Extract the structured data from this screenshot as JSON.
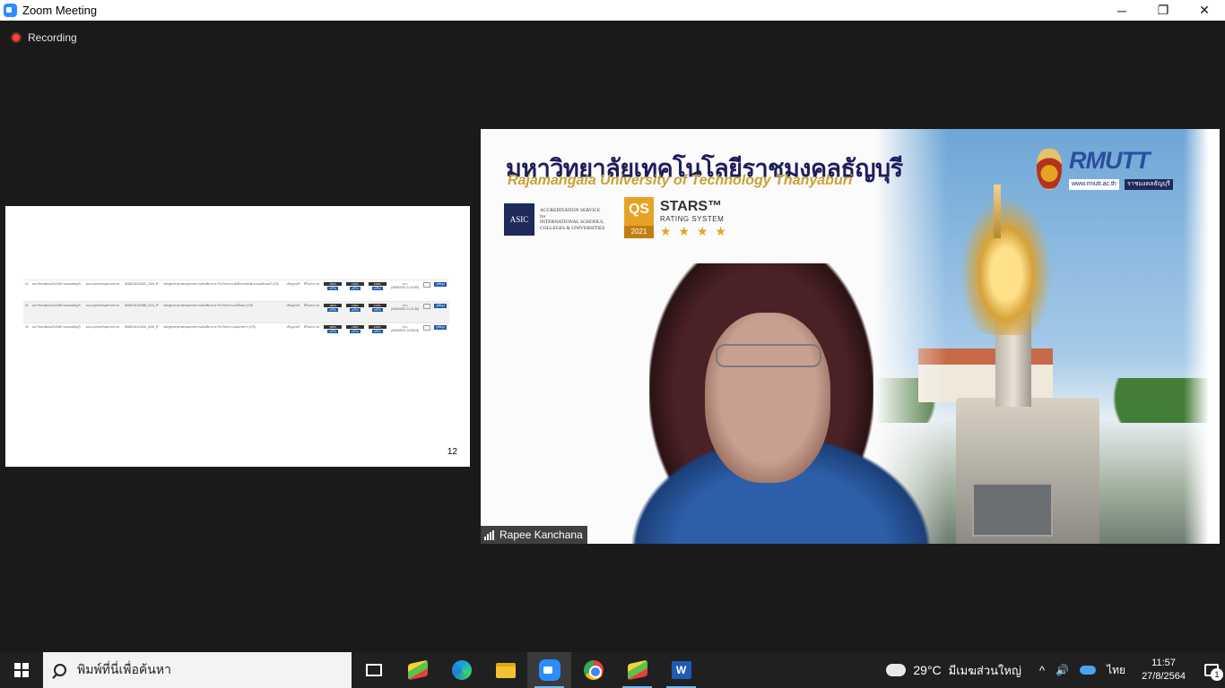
{
  "window": {
    "title": "Zoom Meeting",
    "controls": {
      "minimize": "─",
      "restore": "❐",
      "close": "✕"
    }
  },
  "recording": {
    "label": "Recording"
  },
  "shared_screen": {
    "rows": [
      {
        "no": "01",
        "org": "มหาวิทยาลัยเทคโนโลยีราชมงคลธัญบุรี",
        "faculty": "คณะครุศาสตร์อุตสาหกรรม",
        "code": "25481011104022_2105_IP",
        "program": "หลักสูตรครุศาสตรอุตสาหกรรมบัณฑิต สาขาวิชาวิศวกรรมอิเล็กทรอนิกส์และคอมพิวเตอร์ (4 ปี)",
        "degree": "ปริญญาตรี",
        "status": "มีในประกาศ",
        "p1": "100%",
        "p2": "100%",
        "p3": "100%",
        "btn": "แก้ไข",
        "result": "ผ่าน",
        "date": "(26/08/2021 11:02:59)",
        "detail": "ดูข้อมูล"
      },
      {
        "no": "02",
        "org": "มหาวิทยาลัยเทคโนโลยีราชมงคลธัญบุรี",
        "faculty": "คณะครุศาสตร์อุตสาหกรรม",
        "code": "25481011103086_2124_IP",
        "program": "หลักสูตรครุศาสตรอุตสาหกรรมบัณฑิต สาขาวิชาวิศวกรรมเครื่องกล (4 ปี)",
        "degree": "ปริญญาตรี",
        "status": "มีในประกาศ",
        "p1": "100%",
        "p2": "100%",
        "p3": "100%",
        "btn": "แก้ไข",
        "result": "ผ่าน",
        "date": "(24/08/2021 11:01:36)",
        "detail": "ดูข้อมูล"
      },
      {
        "no": "03",
        "org": "มหาวิทยาลัยเทคโนโลยีราชมงคลธัญบุรี",
        "faculty": "คณะครุศาสตร์อุตสาหกรรม",
        "code": "25481011104033_2108_IP",
        "program": "หลักสูตรครุศาสตรอุตสาหกรรมบัณฑิต สาขาวิชาวิศวกรรมอุตสาหการ (4 ปี)",
        "degree": "ปริญญาตรี",
        "status": "มีในประกาศ",
        "p1": "100%",
        "p2": "100%",
        "p3": "100%",
        "btn": "แก้ไข",
        "result": "ผ่าน",
        "date": "(26/08/2021 10:58:03)",
        "detail": "ดูข้อมูล"
      }
    ],
    "page_number": "12"
  },
  "video": {
    "uni_thai": "มหาวิทยาลัยเทคโนโลยีราชมงคลธัญบุรี",
    "uni_eng": "Rajamangala University of Technology Thanyaburi",
    "asic_logo": "ASIC",
    "asic_text": [
      "ACCREDITATION SERVICE",
      "for",
      "INTERNATIONAL SCHOOLS,",
      "COLLEGES & UNIVERSITIES"
    ],
    "qs_logo": "QS",
    "qs_year": "2021",
    "qs_title": "STARS™",
    "qs_rating": "RATING SYSTEM",
    "qs_stars": "★ ★ ★ ★",
    "rmutt_name": "RMUTT",
    "rmutt_url": "www.rmutt.ac.th",
    "rmutt_tag": "ราชมงคลธัญบุรี",
    "participant_name": "Rapee Kanchana"
  },
  "taskbar": {
    "search_placeholder": "พิมพ์ที่นี่เพื่อค้นหา",
    "weather_temp": "29°C",
    "weather_desc": "มีเมฆส่วนใหญ่",
    "chevron": "^",
    "volume_icon": "🔊",
    "language": "ไทย",
    "time": "11:57",
    "date": "27/8/2564",
    "notification_count": "1",
    "word_letter": "W"
  }
}
